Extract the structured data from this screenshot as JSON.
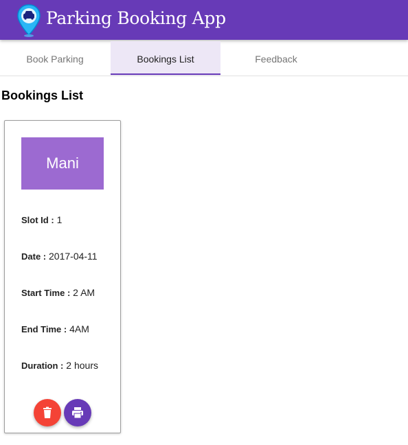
{
  "app": {
    "title": "Parking Booking App"
  },
  "tabs": [
    {
      "label": "Book Parking"
    },
    {
      "label": "Bookings List"
    },
    {
      "label": "Feedback"
    }
  ],
  "active_tab": "Bookings List",
  "section_title": "Bookings List",
  "booking": {
    "name": "Mani",
    "slot_label": "Slot Id :",
    "slot_value": "1",
    "date_label": "Date :",
    "date_value": "2017-04-11",
    "start_label": "Start Time :",
    "start_value": "2 AM",
    "end_label": "End Time :",
    "end_value": "4AM",
    "duration_label": "Duration :",
    "duration_value": "2 hours"
  },
  "colors": {
    "primary": "#673ab7",
    "name_box": "#9c6ad1",
    "delete": "#f44336",
    "active_tab_bg": "#ede7f6"
  },
  "icons": {
    "logo": "map-pin-car-icon",
    "delete": "trash-icon",
    "print": "printer-icon"
  }
}
